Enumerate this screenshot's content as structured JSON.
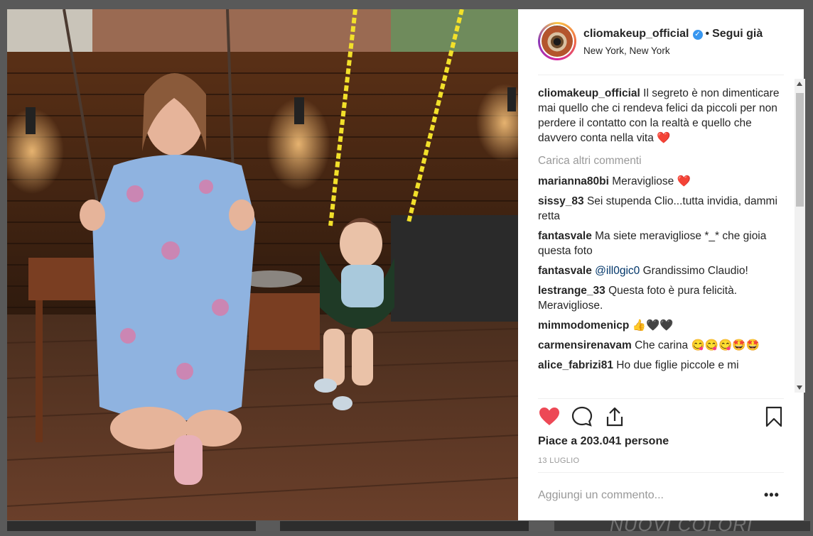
{
  "post": {
    "username": "cliomakeup_official",
    "verified_symbol": "✓",
    "separator": "•",
    "follow_label": "Segui già",
    "location": "New York, New York"
  },
  "caption": {
    "username": "cliomakeup_official",
    "text": "Il segreto è non dimenticare mai quello che ci rendeva felici da piccoli per non perdere il contatto con la realtà e quello che davvero conta nella vita",
    "emoji": "❤️"
  },
  "load_more_label": "Carica altri commenti",
  "comments": [
    {
      "user": "marianna80bi",
      "text": "Meravigliose",
      "emoji": "❤️"
    },
    {
      "user": "sissy_83",
      "text": "Sei stupenda Clio...tutta invidia, dammi retta",
      "emoji": ""
    },
    {
      "user": "fantasvale",
      "text": "Ma siete meravigliose *_* che gioia questa foto",
      "emoji": ""
    },
    {
      "user": "fantasvale",
      "mention": "@ill0gic0",
      "text": "Grandissimo Claudio!",
      "emoji": ""
    },
    {
      "user": "lestrange_33",
      "text": "Questa foto è pura felicità. Meravigliose.",
      "emoji": ""
    },
    {
      "user": "mimmodomenicp",
      "text": "",
      "emoji": "👍🖤🖤"
    },
    {
      "user": "carmensirenavam",
      "text": "Che carina",
      "emoji": "😋😋😋🤩🤩"
    },
    {
      "user": "alice_fabrizi81",
      "text": "Ho due figlie piccole e mi",
      "emoji": ""
    }
  ],
  "actions": {
    "like_icon": "heart-filled-icon",
    "comment_icon": "comment-bubble-icon",
    "share_icon": "share-upload-icon",
    "save_icon": "bookmark-icon",
    "like_color": "#ed4956"
  },
  "likes_text": "Piace a 203.041 persone",
  "date_text": "13 LUGLIO",
  "add_comment_placeholder": "Aggiungi un commento...",
  "more_label": "•••",
  "backdrop_text": "NUOVI COLORI"
}
